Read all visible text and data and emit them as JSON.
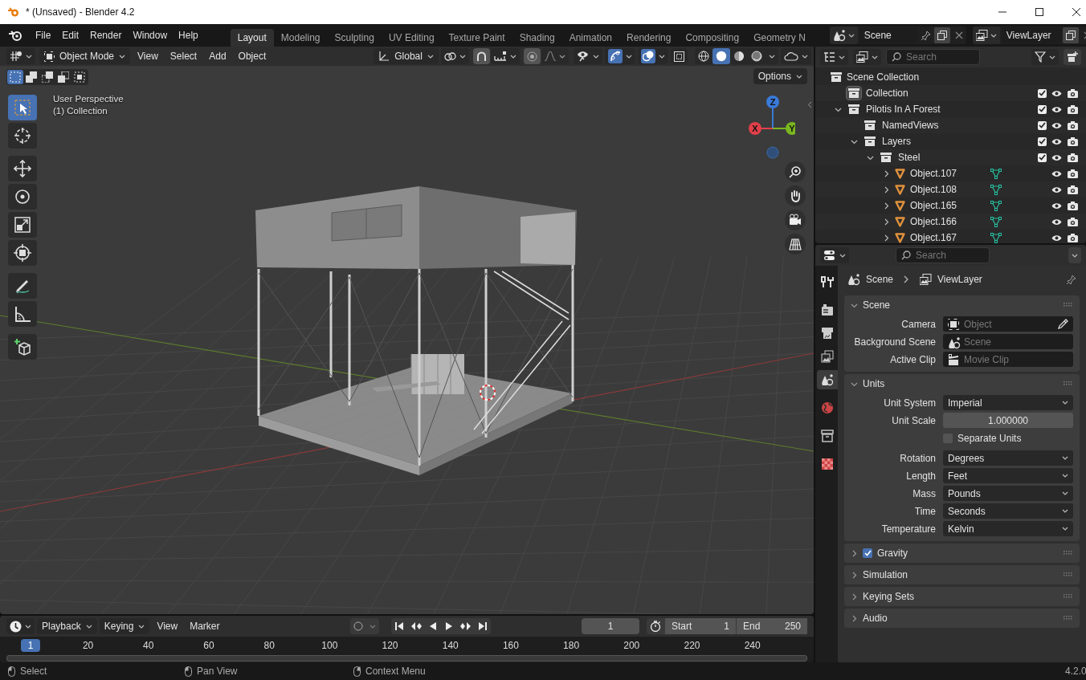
{
  "window": {
    "title": "* (Unsaved) - Blender 4.2"
  },
  "menu": [
    "File",
    "Edit",
    "Render",
    "Window",
    "Help"
  ],
  "workspaces": [
    {
      "label": "Layout",
      "selected": true
    },
    {
      "label": "Modeling",
      "selected": false
    },
    {
      "label": "Sculpting",
      "selected": false
    },
    {
      "label": "UV Editing",
      "selected": false
    },
    {
      "label": "Texture Paint",
      "selected": false
    },
    {
      "label": "Shading",
      "selected": false
    },
    {
      "label": "Animation",
      "selected": false
    },
    {
      "label": "Rendering",
      "selected": false
    },
    {
      "label": "Compositing",
      "selected": false
    },
    {
      "label": "Geometry N",
      "selected": false
    }
  ],
  "scene_field": {
    "value": "Scene"
  },
  "view_layer_field": {
    "value": "ViewLayer"
  },
  "viewport": {
    "mode": "Object Mode",
    "menus": [
      "View",
      "Select",
      "Add",
      "Object"
    ],
    "orientation": "Global",
    "options": "Options",
    "info": [
      "User Perspective",
      "(1) Collection"
    ],
    "select_modes": [
      {
        "selected": true
      },
      {
        "selected": false
      },
      {
        "selected": false
      },
      {
        "selected": false
      },
      {
        "selected": false
      }
    ],
    "shading": [
      {
        "selected": false
      },
      {
        "selected": true
      },
      {
        "selected": false
      },
      {
        "selected": false
      }
    ],
    "tools": [
      {
        "kind": "select",
        "selected": true
      },
      {
        "kind": "cursor",
        "selected": false
      },
      {
        "kind": "move",
        "selected": false
      },
      {
        "kind": "rotate",
        "selected": false
      },
      {
        "kind": "scale",
        "selected": false
      },
      {
        "kind": "transform",
        "selected": false
      },
      {
        "kind": "annotate",
        "selected": false
      },
      {
        "kind": "measure",
        "selected": false
      },
      {
        "kind": "add",
        "selected": false
      }
    ],
    "gizmo": {
      "z": "Z",
      "x": "X",
      "y": "Y"
    }
  },
  "outliner": {
    "search": {
      "placeholder": "Search"
    },
    "tree": [
      {
        "label": "Scene Collection",
        "kind": "scene",
        "children": [
          {
            "label": "Collection",
            "kind": "collection",
            "active": true,
            "checked": true
          },
          {
            "label": "Pilotis In A Forest",
            "kind": "collection",
            "active": false,
            "checked": true,
            "expanded": true,
            "children": [
              {
                "label": "NamedViews",
                "kind": "collection",
                "active": false,
                "checked": true
              },
              {
                "label": "Layers",
                "kind": "collection",
                "active": false,
                "checked": true,
                "expanded": true,
                "children": [
                  {
                    "label": "Steel",
                    "kind": "collection",
                    "active": false,
                    "checked": true,
                    "expanded": true,
                    "children": [
                      {
                        "label": "Object.107",
                        "kind": "object",
                        "expanded": false
                      },
                      {
                        "label": "Object.108",
                        "kind": "object",
                        "expanded": false
                      },
                      {
                        "label": "Object.165",
                        "kind": "object",
                        "expanded": false
                      },
                      {
                        "label": "Object.166",
                        "kind": "object",
                        "expanded": false
                      },
                      {
                        "label": "Object.167",
                        "kind": "object",
                        "expanded": false
                      }
                    ]
                  }
                ]
              }
            ]
          }
        ]
      }
    ]
  },
  "properties": {
    "search": {
      "placeholder": "Search"
    },
    "tabs": [
      {
        "kind": "tool",
        "selected": false
      },
      {
        "kind": "render",
        "selected": false
      },
      {
        "kind": "output",
        "selected": false
      },
      {
        "kind": "view_layer",
        "selected": false
      },
      {
        "kind": "scene",
        "selected": true
      },
      {
        "kind": "world",
        "selected": false
      },
      {
        "kind": "collection",
        "selected": false
      },
      {
        "kind": "texture",
        "selected": false
      }
    ],
    "breadcrumb": [
      "Scene",
      "ViewLayer"
    ],
    "panels": [
      {
        "title": "Scene",
        "expanded": true,
        "fields": [
          {
            "kind": "picker",
            "label": "Camera",
            "placeholder": "Object"
          },
          {
            "kind": "picker",
            "label": "Background Scene",
            "placeholder": "Scene"
          },
          {
            "kind": "picker",
            "label": "Active Clip",
            "placeholder": "Movie Clip"
          }
        ]
      },
      {
        "title": "Units",
        "expanded": true,
        "fields": [
          {
            "kind": "dropdown",
            "label": "Unit System",
            "value": "Imperial"
          },
          {
            "kind": "number",
            "label": "Unit Scale",
            "value": "1.000000"
          },
          {
            "kind": "checkbox",
            "label": "Separate Units",
            "checked": false
          },
          {
            "kind": "dropdown",
            "label": "Rotation",
            "value": "Degrees"
          },
          {
            "kind": "dropdown",
            "label": "Length",
            "value": "Feet"
          },
          {
            "kind": "dropdown",
            "label": "Mass",
            "value": "Pounds"
          },
          {
            "kind": "dropdown",
            "label": "Time",
            "value": "Seconds"
          },
          {
            "kind": "dropdown",
            "label": "Temperature",
            "value": "Kelvin"
          }
        ]
      },
      {
        "title": "Gravity",
        "expanded": false,
        "checked": true
      },
      {
        "title": "Simulation",
        "expanded": false
      },
      {
        "title": "Keying Sets",
        "expanded": false
      },
      {
        "title": "Audio",
        "expanded": false
      }
    ]
  },
  "timeline": {
    "menus": [
      "Playback",
      "Keying",
      "View",
      "Marker"
    ],
    "current_frame": "1",
    "start_label": "Start",
    "start": "1",
    "end_label": "End",
    "end": "250",
    "playhead": "1",
    "ticks": [
      "20",
      "40",
      "60",
      "80",
      "100",
      "120",
      "140",
      "160",
      "180",
      "200",
      "220",
      "240"
    ]
  },
  "status_bar": {
    "hints": [
      "Select",
      "Pan View",
      "Context Menu"
    ],
    "version": "4.2.0"
  }
}
